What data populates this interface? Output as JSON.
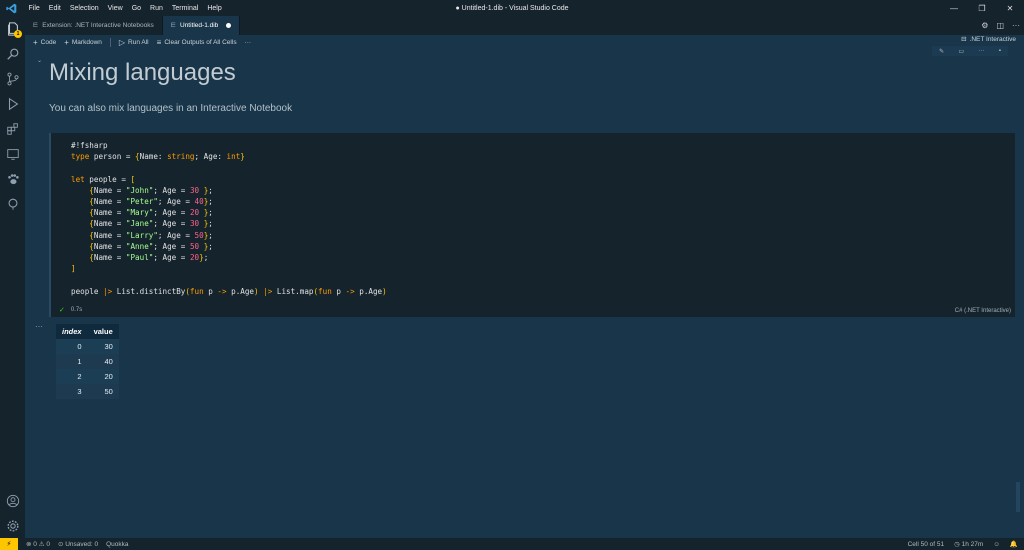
{
  "window": {
    "title": "● Untitled-1.dib - Visual Studio Code",
    "menu": [
      "File",
      "Edit",
      "Selection",
      "View",
      "Go",
      "Run",
      "Terminal",
      "Help"
    ]
  },
  "tabs": [
    {
      "label": "Extension: .NET Interactive Notebooks",
      "icon": "extension-icon"
    },
    {
      "label": "Untitled-1.dib",
      "icon": "notebook-icon",
      "modified": true
    }
  ],
  "activity_badge": "1",
  "toolbar": {
    "code_label": "Code",
    "markdown_label": "Markdown",
    "run_all_label": "Run All",
    "clear_label": "Clear Outputs of All Cells",
    "more_label": "···",
    "kernel_label": ".NET Interactive"
  },
  "markdown": {
    "heading": "Mixing languages",
    "paragraph": "You can also mix languages in an Interactive Notebook"
  },
  "code_cell": {
    "lines": [
      "#!fsharp",
      "type person = {Name: string; Age: int}",
      "",
      "let people = [",
      "    {Name = \"John\"; Age = 30 };",
      "    {Name = \"Peter\"; Age = 40};",
      "    {Name = \"Mary\"; Age = 20 };",
      "    {Name = \"Jane\"; Age = 30 };",
      "    {Name = \"Larry\"; Age = 50};",
      "    {Name = \"Anne\"; Age = 50 };",
      "    {Name = \"Paul\"; Age = 20};",
      "]",
      "",
      "people |> List.distinctBy(fun p -> p.Age) |> List.map(fun p -> p.Age)"
    ],
    "exec_time": "0.7s",
    "language": "C# (.NET Interactive)"
  },
  "output": {
    "more": "···",
    "columns": [
      "index",
      "value"
    ],
    "rows": [
      {
        "index": "0",
        "value": "30"
      },
      {
        "index": "1",
        "value": "40"
      },
      {
        "index": "2",
        "value": "20"
      },
      {
        "index": "3",
        "value": "50"
      }
    ]
  },
  "statusbar": {
    "errors": "0",
    "warnings": "0",
    "unsaved": "Unsaved: 0",
    "quokka": "Quokka",
    "cell_pos": "Cell 50 of 51",
    "time": "1h 27m"
  }
}
